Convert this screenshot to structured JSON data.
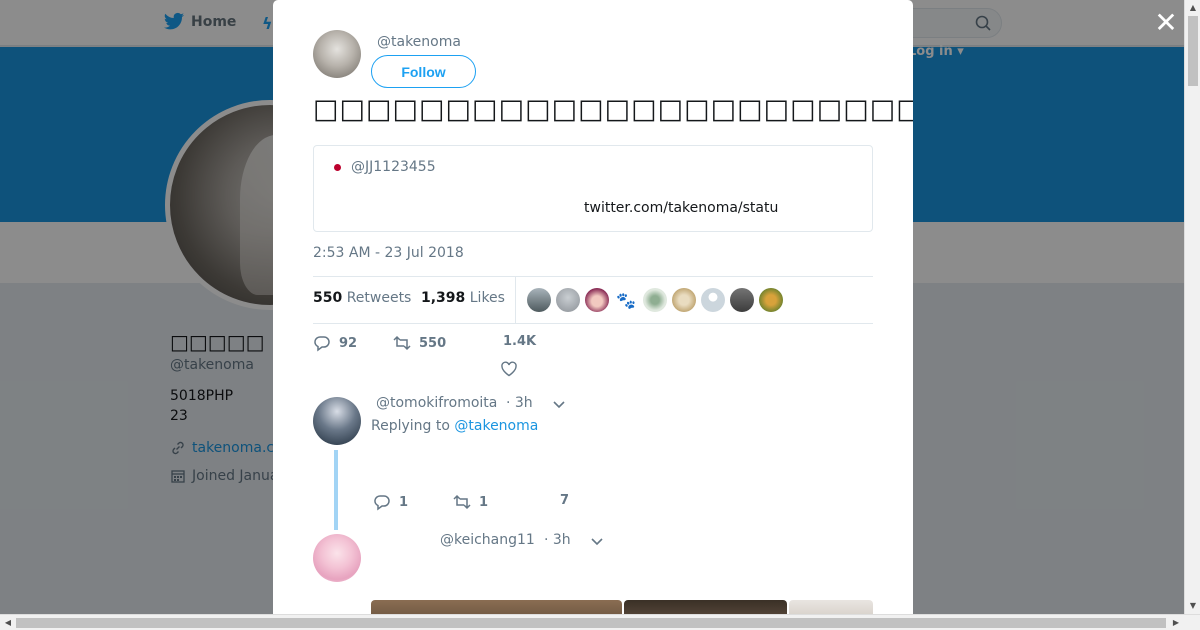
{
  "nav": {
    "home_label": "Home",
    "login_label": "Log in ▾"
  },
  "profile": {
    "name": "□□□□□",
    "handle": "@takenoma",
    "bio_line1": "5018PHP",
    "bio_line2": "23",
    "link": "takenoma.c",
    "joined": "Joined Janua"
  },
  "tweet": {
    "handle": "@takenoma",
    "follow_label": "Follow",
    "text": "□□□□□□□□□□□□□□□□□□□□□□□□□□□□□□□□□□□□□□□□□□□□□",
    "quote_handle": "@JJ1123455",
    "quote_link": "twitter.com/takenoma/statu",
    "timestamp": "2:53 AM - 23 Jul 2018",
    "retweets_count": "550",
    "retweets_label": "Retweets",
    "likes_count": "1,398",
    "likes_label": "Likes",
    "actions": {
      "replies": "92",
      "retweets": "550",
      "likes": "1.4K"
    }
  },
  "replies": [
    {
      "handle": "@tomokifromoita",
      "time": "· 3h",
      "replying_prefix": "Replying to",
      "replying_to": "@takenoma",
      "actions": {
        "replies": "1",
        "retweets": "1",
        "likes": "7"
      }
    },
    {
      "handle": "@keichang11",
      "time": "· 3h"
    }
  ],
  "colors": {
    "accent": "#1da1f2",
    "banner": "#1b95e0",
    "thread_line": "#a2d4f5"
  }
}
